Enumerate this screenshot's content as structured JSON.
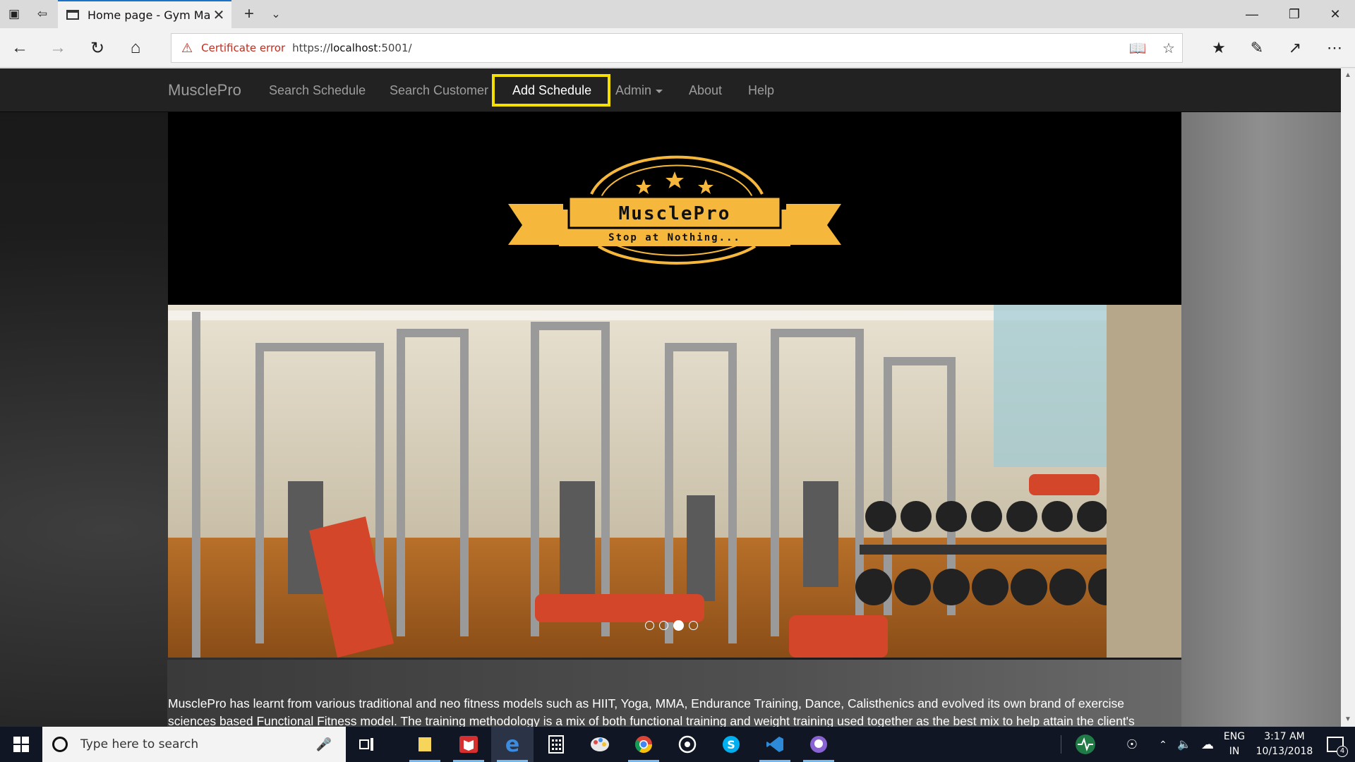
{
  "browser": {
    "tab_title": "Home page - Gym Man",
    "cert_error": "Certificate error",
    "url_scheme": "https://",
    "url_host": "localhost",
    "url_rest": ":5001/"
  },
  "site": {
    "brand": "MusclePro",
    "nav": {
      "search_schedule": "Search Schedule",
      "search_customer": "Search Customer",
      "add_schedule": "Add Schedule",
      "admin": "Admin",
      "about": "About",
      "help": "Help"
    },
    "logo": {
      "name": "MusclePro",
      "tagline": "Stop at Nothing..."
    },
    "carousel": {
      "slide_count": 4,
      "active_index": 2
    },
    "intro_text": "MusclePro has learnt from various traditional and neo fitness models such as HIIT, Yoga, MMA, Endurance Training, Dance, Calisthenics and evolved its own brand of exercise sciences based Functional Fitness model. The training methodology is a mix of both functional training and weight training used together as the best mix to help attain the client's"
  },
  "taskbar": {
    "search_placeholder": "Type here to search",
    "lang_line1": "ENG",
    "lang_line2": "IN",
    "time": "3:17 AM",
    "date": "10/13/2018",
    "notification_count": "4"
  },
  "colors": {
    "logo_gold": "#f6b83c",
    "highlight_yellow": "#f5e000",
    "nav_text": "#9d9d9d",
    "cert_error_red": "#c42b1c"
  }
}
